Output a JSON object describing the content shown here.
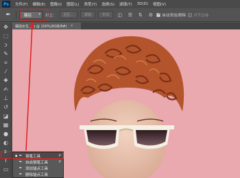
{
  "app": {
    "logo": "Ps"
  },
  "menubar": {
    "items": [
      "文件(F)",
      "编辑(E)",
      "图像(I)",
      "图层(L)",
      "类型(Y)",
      "选择(S)",
      "滤镜(T)",
      "3D(D)",
      "视图(V)"
    ]
  },
  "options": {
    "mode_select": "路径",
    "build_label": "建立：",
    "buttons": [
      "选区...",
      "蒙版",
      "形状"
    ],
    "auto_add_delete": "自动添加/删除",
    "auto_add_delete_checked": true,
    "align_edges": "对齐边缘",
    "align_edges_checked": false
  },
  "document": {
    "tab_title": "摆拍女生.jpg @ 100%(RGB/8#)",
    "close": "×"
  },
  "tools": [
    "move-icon",
    "marquee-icon",
    "lasso-icon",
    "quick-select-icon",
    "crop-icon",
    "eyedropper-icon",
    "healing-icon",
    "brush-icon",
    "stamp-icon",
    "history-brush-icon",
    "eraser-icon",
    "gradient-icon",
    "blur-icon",
    "dodge-icon",
    "pen-icon",
    "type-icon",
    "path-select-icon",
    "shape-icon"
  ],
  "flyout": {
    "items": [
      {
        "label": "钢笔工具",
        "key": "P",
        "selected": true
      },
      {
        "label": "自由钢笔工具",
        "key": "P",
        "selected": false
      },
      {
        "label": "添加锚点工具",
        "key": "",
        "selected": false
      },
      {
        "label": "删除锚点工具",
        "key": "",
        "selected": false
      }
    ]
  },
  "colors": {
    "canvas_bg": "#e9a9ae",
    "highlight": "#e02020",
    "hair": "#b4542c"
  }
}
